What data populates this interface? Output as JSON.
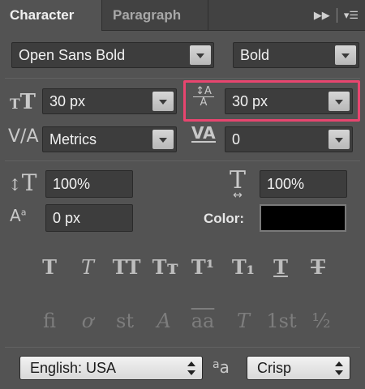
{
  "tabs": [
    {
      "label": "Character",
      "active": true
    },
    {
      "label": "Paragraph",
      "active": false
    }
  ],
  "font": {
    "family": "Open Sans Bold",
    "style": "Bold"
  },
  "size": {
    "value": "30 px",
    "icon": "font-size-icon"
  },
  "leading": {
    "value": "30 px",
    "icon": "leading-icon",
    "highlight_color": "#e8456f"
  },
  "kerning": {
    "value": "Metrics",
    "icon": "kerning-icon"
  },
  "tracking": {
    "value": "0",
    "icon": "tracking-icon"
  },
  "vertical_scale": {
    "value": "100%",
    "icon": "vertical-scale-icon"
  },
  "horizontal_scale": {
    "value": "100%",
    "icon": "horizontal-scale-icon"
  },
  "baseline_shift": {
    "value": "0 px",
    "icon": "baseline-shift-icon"
  },
  "color": {
    "label": "Color:",
    "value": "#000000"
  },
  "type_styles": [
    {
      "glyph": "T",
      "name": "faux-bold-icon"
    },
    {
      "glyph": "T",
      "name": "faux-italic-icon"
    },
    {
      "glyph": "TT",
      "name": "all-caps-icon"
    },
    {
      "glyph": "Tт",
      "name": "small-caps-icon"
    },
    {
      "glyph": "T¹",
      "name": "superscript-icon"
    },
    {
      "glyph": "T₁",
      "name": "subscript-icon"
    },
    {
      "glyph": "T",
      "name": "underline-icon"
    },
    {
      "glyph": "T",
      "name": "strikethrough-icon"
    }
  ],
  "opentype": [
    {
      "glyph": "fi",
      "name": "standard-ligatures-icon"
    },
    {
      "glyph": "ơ",
      "name": "contextual-alternates-icon"
    },
    {
      "glyph": "st",
      "name": "discretionary-ligatures-icon"
    },
    {
      "glyph": "A",
      "name": "swash-icon"
    },
    {
      "glyph": "aa",
      "name": "stylistic-alternates-icon"
    },
    {
      "glyph": "T",
      "name": "titling-alternates-icon"
    },
    {
      "glyph": "1st",
      "name": "ordinals-icon"
    },
    {
      "glyph": "½",
      "name": "fractions-icon"
    }
  ],
  "language": {
    "value": "English: USA"
  },
  "antialias": {
    "icon_text": "aa",
    "value": "Crisp"
  }
}
